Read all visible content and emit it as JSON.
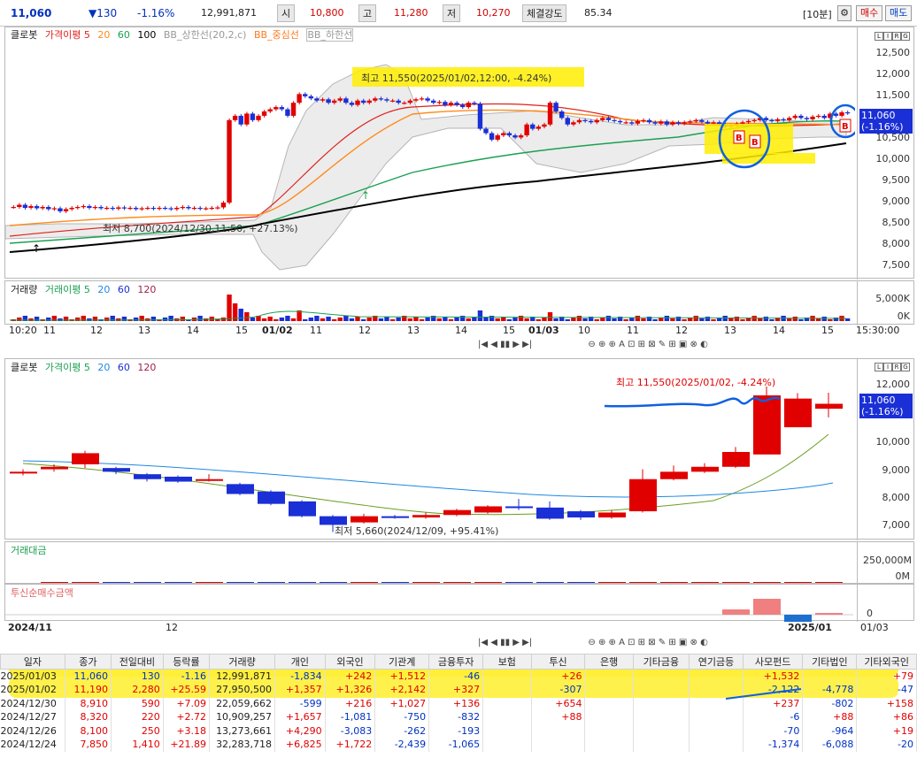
{
  "header": {
    "price": "11,060",
    "change": "▼130",
    "change_pct": "-1.16%",
    "volume": "12,991,871",
    "open_label": "시",
    "open": "10,800",
    "high_label": "고",
    "high": "11,280",
    "low_label": "저",
    "low": "10,270",
    "strength_label": "체결강도",
    "strength": "85.34",
    "interval": "[10분]",
    "buy_label": "매수",
    "sell_label": "매도"
  },
  "colors": {
    "up": "#e00000",
    "down": "#1a2fd6",
    "ma5": "#e0201c",
    "ma20": "#ff8a1c",
    "ma60": "#1aa050",
    "ma120": "#000000",
    "highlight": "#ffee00"
  },
  "chart1": {
    "legend": [
      "클로봇",
      "가격이평 5",
      "20",
      "60",
      "100",
      "BB_상한선(20,2,c)",
      "BB_중심선",
      "BB_하한선"
    ],
    "yticks": [
      "12,500",
      "12,000",
      "11,500",
      "11,000",
      "10,500",
      "10,000",
      "9,500",
      "9,000",
      "8,500",
      "8,000",
      "7,500"
    ],
    "price_tag": "11,060",
    "price_tag_pct": "(-1.16%)",
    "high_note": "최고 11,550(2025/01/02,12:00, -4.24%)",
    "low_note": "최저 8,700(2024/12/30,11:50, +27.13%)",
    "scale_buttons": [
      "L",
      "I",
      "R",
      "G"
    ]
  },
  "volume1": {
    "legend": [
      "거래량",
      "거래이평 5",
      "20",
      "60",
      "120"
    ],
    "yticks": [
      "5,000K",
      "0K"
    ]
  },
  "xaxis1": {
    "labels": [
      "10:20",
      "11",
      "12",
      "13",
      "14",
      "15",
      "01/02",
      "11",
      "12",
      "13",
      "14",
      "15",
      "01/03",
      "10",
      "11",
      "12",
      "13",
      "14",
      "15"
    ],
    "end": "15:30:00"
  },
  "chart2": {
    "legend": [
      "클로봇",
      "가격이평 5",
      "20",
      "60",
      "120"
    ],
    "yticks": [
      "12,000",
      "11,000",
      "10,000",
      "9,000",
      "8,000",
      "7,000",
      "6,000"
    ],
    "price_tag": "11,060",
    "price_tag_pct": "(-1.16%)",
    "high_note": "최고 11,550(2025/01/02, -4.24%)",
    "low_note": "최저 5,660(2024/12/09, +95.41%)"
  },
  "amount2": {
    "legend": "거래대금",
    "yticks": [
      "250,000M",
      "0M"
    ]
  },
  "invest2": {
    "legend": "투신순매수금액",
    "yticks": [
      "0"
    ]
  },
  "xaxis2": {
    "labels": [
      "2024/11",
      "12",
      "2025/01"
    ],
    "end": "01/03"
  },
  "chart_data": [
    {
      "type": "candlestick",
      "title": "클로봇 (10분)",
      "ylim": [
        7250,
        12750
      ],
      "candles_x": [
        1,
        2,
        3,
        4,
        5,
        6,
        7,
        8,
        9,
        10,
        11,
        12,
        13,
        14,
        15,
        16,
        17,
        18,
        19,
        20,
        21,
        22,
        23,
        24,
        25,
        26,
        27,
        28,
        29,
        30,
        31,
        32,
        33,
        34,
        35,
        36,
        37,
        38,
        39,
        40,
        41,
        42,
        43,
        44,
        45,
        46,
        47,
        48,
        49,
        50,
        51,
        52,
        53,
        54,
        55,
        56,
        57,
        58,
        59,
        60,
        61,
        62,
        63,
        64,
        65,
        66,
        67,
        68,
        69,
        70,
        71,
        72,
        73,
        74,
        75,
        76,
        77,
        78,
        79,
        80,
        81,
        82,
        83,
        84,
        85,
        86,
        87,
        88,
        89,
        90,
        91,
        92,
        93,
        94,
        95,
        96,
        97,
        98,
        99,
        100,
        101,
        102,
        103,
        104,
        105,
        106,
        107,
        108,
        109,
        110,
        111,
        112,
        113,
        114,
        115,
        116,
        117,
        118,
        119,
        120,
        121,
        122,
        123,
        124,
        125,
        126,
        127,
        128,
        129,
        130,
        131,
        132,
        133,
        134,
        135,
        136,
        137,
        138,
        139,
        140,
        141,
        142,
        143,
        144
      ],
      "close": [
        8900,
        8950,
        8880,
        8920,
        8870,
        8900,
        8850,
        8870,
        8800,
        8850,
        8880,
        8900,
        8920,
        8880,
        8900,
        8870,
        8880,
        8860,
        8890,
        8870,
        8880,
        8850,
        8870,
        8880,
        8860,
        8880,
        8870,
        8850,
        8880,
        8900,
        8870,
        8880,
        8860,
        8870,
        8880,
        8890,
        9000,
        10900,
        11000,
        10800,
        11050,
        10900,
        11000,
        11100,
        11150,
        11200,
        11150,
        11000,
        11300,
        11500,
        11450,
        11400,
        11350,
        11380,
        11300,
        11350,
        11400,
        11300,
        11250,
        11350,
        11300,
        11350,
        11400,
        11380,
        11350,
        11350,
        11300,
        11300,
        11350,
        11380,
        11400,
        11350,
        11300,
        11320,
        11250,
        11300,
        11250,
        11200,
        11300,
        11280,
        10700,
        10600,
        10450,
        10550,
        10600,
        10550,
        10500,
        10550,
        10800,
        10700,
        10750,
        10800,
        11300,
        11100,
        10950,
        10800,
        10850,
        10900,
        10880,
        10850,
        10900,
        10950,
        10900,
        10880,
        10850,
        10850,
        10820,
        10880,
        10900,
        10850,
        10820,
        10870,
        10800,
        10850,
        10820,
        10850,
        10870,
        10900,
        10860,
        10820,
        10850,
        10800,
        10750,
        10780,
        10820,
        10850,
        10880,
        10900,
        10950,
        10900,
        10880,
        10920,
        10900,
        10950,
        11000,
        10950,
        10920,
        10980,
        11000,
        10950,
        11050,
        11000,
        11080,
        11060
      ],
      "ma": {
        "ma5_end": 10980,
        "ma20_end": 10950,
        "ma60_end": 10650,
        "ma100_end": 10300
      },
      "annotations": [
        "최고 11,550",
        "최저 8,700"
      ]
    },
    {
      "type": "candlestick",
      "title": "클로봇 (일)",
      "ylim": [
        5500,
        12300
      ],
      "open": [
        8050,
        8200,
        8400,
        8250,
        8000,
        7900,
        7800,
        7600,
        7300,
        6900,
        6300,
        6050,
        6300,
        6250,
        6350,
        6450,
        6700,
        6650,
        6500,
        6250,
        6500,
        7800,
        8100,
        8300,
        8800,
        9900,
        10650
      ],
      "close": [
        8100,
        8300,
        8850,
        8100,
        7800,
        7700,
        7800,
        7200,
        6800,
        6300,
        5950,
        6300,
        6250,
        6350,
        6550,
        6700,
        6650,
        6200,
        6250,
        6450,
        7800,
        8100,
        8300,
        8900,
        11190,
        11060,
        10850
      ],
      "high": [
        8200,
        8400,
        8950,
        8300,
        8050,
        7950,
        8000,
        7650,
        7350,
        6950,
        6350,
        6400,
        6350,
        6450,
        6600,
        6750,
        7000,
        6900,
        6550,
        6550,
        8200,
        8350,
        8450,
        9100,
        11550,
        11280,
        11300
      ],
      "low": [
        7950,
        8100,
        8250,
        8000,
        7700,
        7650,
        7700,
        7150,
        6750,
        6250,
        5660,
        6000,
        6200,
        6200,
        6300,
        6400,
        6550,
        6150,
        6150,
        6200,
        6450,
        7750,
        8050,
        8250,
        9700,
        10270,
        10300
      ],
      "annotations": [
        "최고 11,550",
        "최저 5,660"
      ]
    },
    {
      "type": "bar",
      "title": "거래대금",
      "values": [
        5,
        4,
        6,
        5,
        4,
        5,
        6,
        4,
        5,
        6,
        7,
        5,
        4,
        5,
        6,
        5,
        4,
        5,
        6,
        5,
        150,
        80,
        65,
        120,
        240,
        90
      ],
      "ylim": [
        0,
        300000
      ]
    },
    {
      "type": "bar",
      "title": "투신순매수금액",
      "values": [
        0,
        0,
        0,
        0,
        0,
        0,
        0,
        0,
        0,
        0,
        0,
        0,
        0,
        0,
        0,
        0,
        0,
        0,
        0,
        0,
        0,
        0,
        6,
        18,
        -8,
        2
      ],
      "ylim": [
        -10,
        20
      ]
    },
    {
      "type": "table",
      "columns": [
        "일자",
        "종가",
        "전일대비",
        "등락률",
        "거래량",
        "개인",
        "외국인",
        "기관계",
        "금융투자",
        "보험",
        "투신",
        "은행",
        "기타금융",
        "연기금등",
        "사모펀드",
        "기타법인",
        "기타외국인"
      ],
      "rows": [
        [
          "2025/01/03",
          "11,060",
          "130",
          "-1.16",
          "12,991,871",
          "-1,834",
          "+242",
          "+1,512",
          "-46",
          "",
          "+26",
          "",
          "",
          "",
          "+1,532",
          "",
          "+79"
        ],
        [
          "2025/01/02",
          "11,190",
          "2,280",
          "+25.59",
          "27,950,500",
          "+1,357",
          "+1,326",
          "+2,142",
          "+327",
          "",
          "-307",
          "",
          "",
          "",
          "-2,122",
          "-4,778",
          "-47"
        ],
        [
          "2024/12/30",
          "8,910",
          "590",
          "+7.09",
          "22,059,662",
          "-599",
          "+216",
          "+1,027",
          "+136",
          "",
          "+654",
          "",
          "",
          "",
          "+237",
          "-802",
          "+158"
        ],
        [
          "2024/12/27",
          "8,320",
          "220",
          "+2.72",
          "10,909,257",
          "+1,657",
          "-1,081",
          "-750",
          "-832",
          "",
          "+88",
          "",
          "",
          "",
          "-6",
          "+88",
          "+86"
        ],
        [
          "2024/12/26",
          "8,100",
          "250",
          "+3.18",
          "13,273,661",
          "+4,290",
          "-3,083",
          "-262",
          "-193",
          "",
          "",
          "",
          "",
          "",
          "-70",
          "-964",
          "+19"
        ],
        [
          "2024/12/24",
          "7,850",
          "1,410",
          "+21.89",
          "32,283,718",
          "+6,825",
          "+1,722",
          "-2,439",
          "-1,065",
          "",
          "",
          "",
          "",
          "",
          "-1,374",
          "-6,088",
          "-20"
        ]
      ]
    }
  ],
  "table_header": [
    "일자",
    "종가",
    "전일대비",
    "등락률",
    "거래량",
    "개인",
    "외국인",
    "기관계",
    "금융투자",
    "보험",
    "투신",
    "은행",
    "기타금융",
    "연기금등",
    "사모펀드",
    "기타법인",
    "기타외국인"
  ]
}
